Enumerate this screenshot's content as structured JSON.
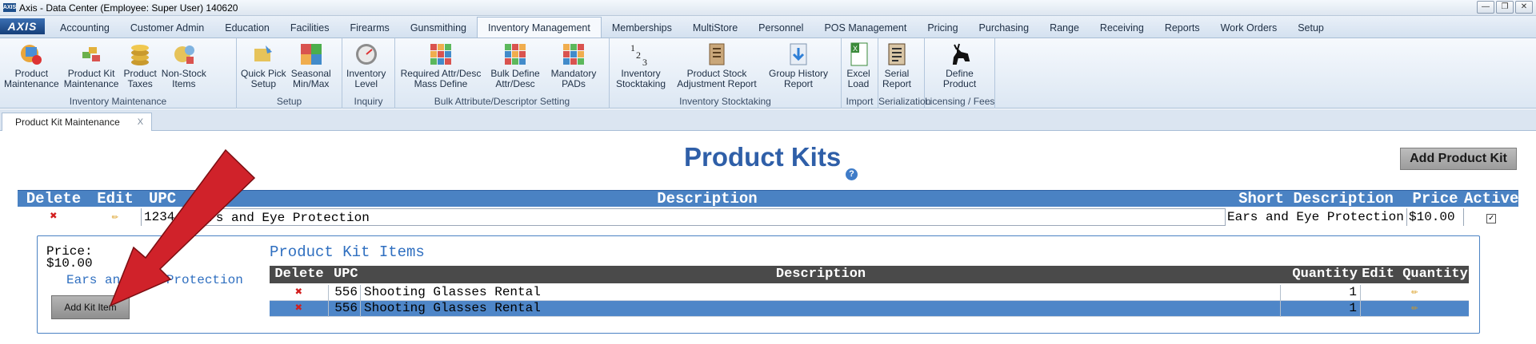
{
  "window": {
    "icon": "AXIS",
    "title": "Axis - Data Center  (Employee: Super User) 140620",
    "controls": [
      "—",
      "❐",
      "✕"
    ]
  },
  "menu": {
    "logo": "AXIS",
    "tabs": [
      "Accounting",
      "Customer Admin",
      "Education",
      "Facilities",
      "Firearms",
      "Gunsmithing",
      "Inventory Management",
      "Memberships",
      "MultiStore",
      "Personnel",
      "POS Management",
      "Pricing",
      "Purchasing",
      "Range",
      "Receiving",
      "Reports",
      "Work Orders",
      "Setup"
    ],
    "active": "Inventory Management"
  },
  "ribbon": {
    "groups": [
      {
        "label": "Inventory Maintenance",
        "buttons": [
          {
            "label": "Product\nMaintenance",
            "icon": "product-maintenance-icon"
          },
          {
            "label": "Product Kit\nMaintenance",
            "icon": "product-kit-icon"
          },
          {
            "label": "Product\nTaxes",
            "icon": "coins-icon"
          },
          {
            "label": "Non-Stock\nItems",
            "icon": "non-stock-icon"
          }
        ]
      },
      {
        "label": "Setup",
        "buttons": [
          {
            "label": "Quick Pick\nSetup",
            "icon": "quick-pick-icon"
          },
          {
            "label": "Seasonal\nMin/Max",
            "icon": "seasonal-icon"
          }
        ]
      },
      {
        "label": "Inquiry",
        "buttons": [
          {
            "label": "Inventory\nLevel",
            "icon": "gauge-icon"
          }
        ]
      },
      {
        "label": "Bulk Attribute/Descriptor Setting",
        "buttons": [
          {
            "label": "Required Attr/Desc\nMass Define",
            "icon": "grid-icon"
          },
          {
            "label": "Bulk Define\nAttr/Desc",
            "icon": "grid-icon"
          },
          {
            "label": "Mandatory\nPADs",
            "icon": "grid-icon"
          }
        ]
      },
      {
        "label": "Inventory Stocktaking",
        "buttons": [
          {
            "label": "Inventory\nStocktaking",
            "icon": "numbers-icon"
          },
          {
            "label": "Product Stock\nAdjustment Report",
            "icon": "report-icon"
          },
          {
            "label": "Group History\nReport",
            "icon": "download-icon"
          }
        ]
      },
      {
        "label": "Import",
        "buttons": [
          {
            "label": "Excel\nLoad",
            "icon": "excel-icon"
          }
        ]
      },
      {
        "label": "Serialization",
        "buttons": [
          {
            "label": "Serial\nReport",
            "icon": "serial-icon"
          }
        ]
      },
      {
        "label": "Licensing / Fees",
        "buttons": [
          {
            "label": "Define\nProduct",
            "icon": "deer-icon"
          }
        ]
      }
    ]
  },
  "doc_tab": {
    "label": "Product Kit Maintenance",
    "close": "X"
  },
  "page": {
    "title": "Product Kits",
    "help": "?",
    "add_kit_label": "Add Product Kit"
  },
  "kits_table": {
    "headers": [
      "Delete",
      "Edit",
      "UPC",
      "Description",
      "Short Description",
      "Price",
      "Active"
    ],
    "rows": [
      {
        "upc": "1234",
        "description": "Ears and Eye Protection",
        "short_description": "Ears and Eye Protection",
        "price": "$10.00",
        "active": true
      }
    ]
  },
  "kit_detail": {
    "price_label": "Price:",
    "price_value": "$10.00",
    "description": "Ears and Eye Protection",
    "add_item_label": "Add Kit Item",
    "items_title": "Product Kit Items",
    "items_headers": [
      "Delete",
      "UPC",
      "Description",
      "Quantity",
      "Edit Quantity"
    ],
    "items": [
      {
        "upc": "556",
        "description": "Shooting Glasses Rental",
        "quantity": "1"
      },
      {
        "upc": "556",
        "description": "Shooting Glasses Rental",
        "quantity": "1"
      }
    ]
  },
  "colors": {
    "accent": "#4a82c3",
    "title": "#2f5fa8",
    "arrow": "#d0222a"
  }
}
